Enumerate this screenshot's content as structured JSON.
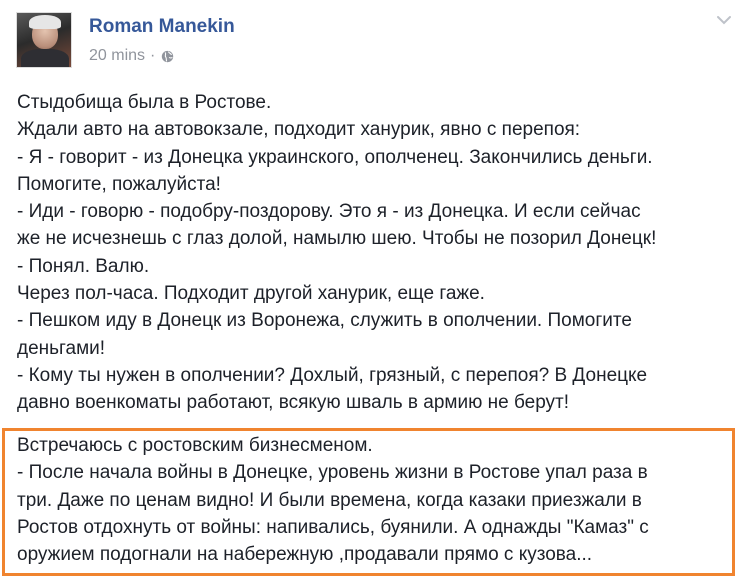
{
  "post": {
    "author": "Roman Manekin",
    "timestamp": "20 mins",
    "separator": "·",
    "privacy_icon": "globe-icon",
    "menu_icon": "chevron-down-icon",
    "body_lines": [
      "Стыдобища была в Ростове.",
      "Ждали авто на автовокзале, подходит ханурик, явно с перепоя:",
      "- Я - говорит - из Донецка украинского, ополченец. Закончились деньги.",
      "Помогите, пожалуйста!",
      "- Иди - говорю - подобру-поздорову. Это я - из Донецка. И если сейчас",
      "же не исчезнешь с глаз долой, намылю шею. Чтобы не позорил Донецк!",
      "- Понял. Валю.",
      "Через пол-часа. Подходит другой ханурик, еще гаже.",
      "- Пешком иду в Донецк из Воронежа, служить в ополчении. Помогите",
      "деньгами!",
      "- Кому ты нужен в ополчении? Дохлый, грязный, с перепоя? В Донецке",
      "давно военкоматы работают, всякую шваль в армию не берут!"
    ],
    "highlighted_lines": [
      "Встречаюсь с ростовским бизнесменом.",
      "- После начала войны в Донецке, уровень жизни в Ростове упал раза в",
      "три. Даже по ценам видно! И были времена, когда казаки приезжали в",
      "Ростов отдохнуть от войны: напивались, буянили. А однажды \"Камаз\" с",
      "оружием подогнали на набережную ,продавали прямо с кузова..."
    ]
  },
  "colors": {
    "author": "#365899",
    "meta": "#90949c",
    "text": "#1d2129",
    "highlight_border": "#f0842f"
  }
}
